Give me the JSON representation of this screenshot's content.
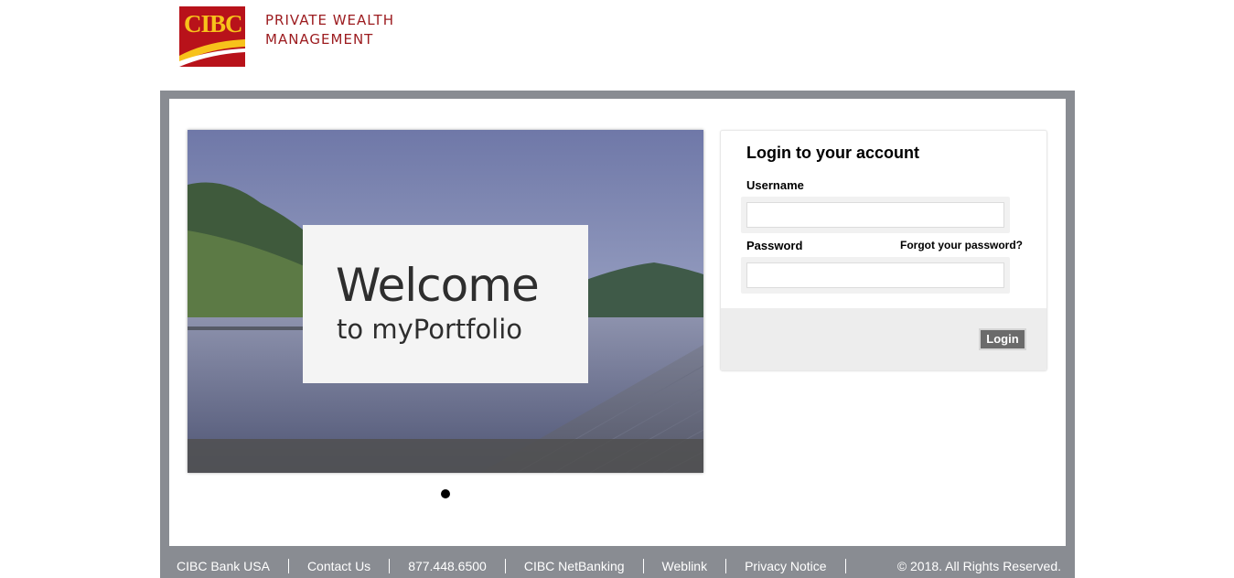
{
  "brand": {
    "logo_text": "CIBC",
    "line1": "PRIVATE WEALTH",
    "line2": "MANAGEMENT",
    "colors": {
      "red": "#b8121a",
      "gold": "#f7c21b",
      "brand_text": "#9c1b1f"
    }
  },
  "hero": {
    "title": "Welcome",
    "subtitle": "to myPortfolio"
  },
  "login": {
    "title": "Login to your account",
    "username_label": "Username",
    "username_value": "",
    "password_label": "Password",
    "password_value": "",
    "forgot_label": "Forgot your password?",
    "button_label": "Login"
  },
  "footer": {
    "links": [
      "CIBC Bank USA",
      "Contact Us",
      "877.448.6500",
      "CIBC NetBanking",
      "Weblink",
      "Privacy Notice"
    ],
    "copyright": "© 2018. All Rights Reserved."
  },
  "frame_color": "#898c92"
}
